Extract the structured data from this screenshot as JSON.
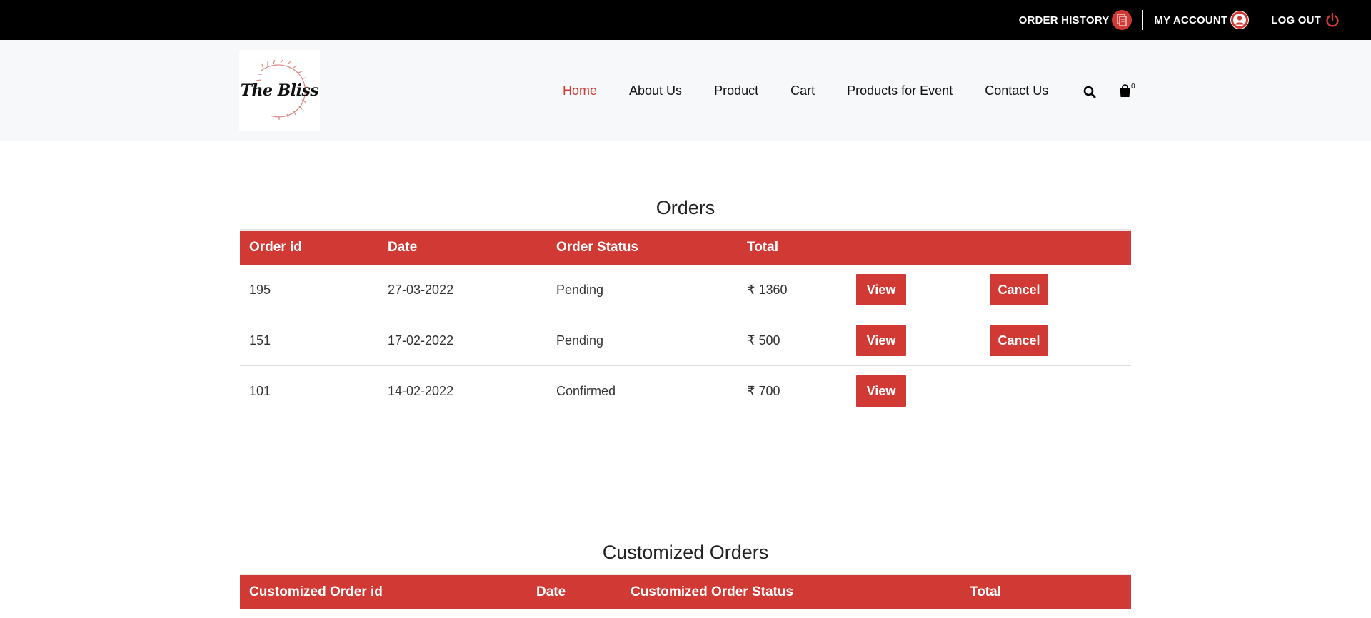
{
  "topbar": {
    "order_history": "ORDER HISTORY",
    "my_account": "MY ACCOUNT",
    "log_out": "LOG OUT"
  },
  "brand": {
    "logo_text": "The Bliss"
  },
  "nav": {
    "items": [
      "Home",
      "About Us",
      "Product",
      "Cart",
      "Products for Event",
      "Contact Us"
    ],
    "active": "Home",
    "cart_count": "0"
  },
  "orders": {
    "title": "Orders",
    "columns": [
      "Order id",
      "Date",
      "Order Status",
      "Total"
    ],
    "rows": [
      {
        "id": "195",
        "date": "27-03-2022",
        "status": "Pending",
        "total": "₹ 1360",
        "view": "View",
        "cancel": "Cancel"
      },
      {
        "id": "151",
        "date": "17-02-2022",
        "status": "Pending",
        "total": "₹ 500",
        "view": "View",
        "cancel": "Cancel"
      },
      {
        "id": "101",
        "date": "14-02-2022",
        "status": "Confirmed",
        "total": "₹ 700",
        "view": "View"
      }
    ]
  },
  "customized_orders": {
    "title": "Customized Orders",
    "columns": [
      "Customized Order id",
      "Date",
      "Customized Order Status",
      "Total"
    ]
  },
  "colors": {
    "accent": "#d13a34",
    "topbar": "#000000",
    "header_bg": "#f7f8fa"
  }
}
